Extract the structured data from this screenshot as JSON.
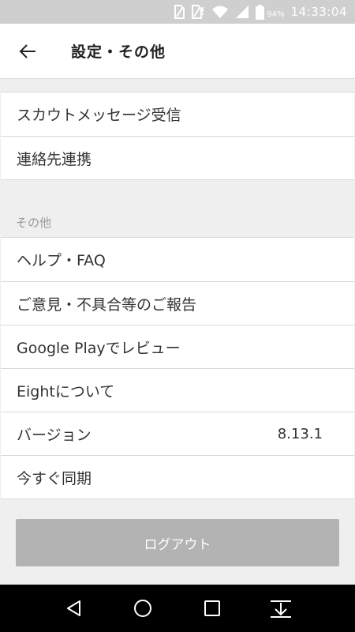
{
  "status_bar": {
    "battery_percent": "94%",
    "time": "14:33:04",
    "icons": [
      "no-sim-icon",
      "no-sim-icon",
      "wifi-icon",
      "signal-icon",
      "battery-icon"
    ]
  },
  "app_bar": {
    "title": "設定・その他",
    "back_icon": "arrow-left-icon"
  },
  "settings_group_1": {
    "items": [
      {
        "label": "スカウトメッセージ受信"
      },
      {
        "label": "連絡先連携"
      }
    ]
  },
  "other_section": {
    "header": "その他",
    "items": [
      {
        "label": "ヘルプ・FAQ"
      },
      {
        "label": "ご意見・不具合等のご報告"
      },
      {
        "label": "Google Playでレビュー"
      },
      {
        "label": "Eightについて"
      },
      {
        "label": "バージョン",
        "value": "8.13.1"
      },
      {
        "label": "今すぐ同期"
      }
    ]
  },
  "logout": {
    "label": "ログアウト",
    "color": "#b3b3b3"
  },
  "nav_bar": {
    "icons": [
      "back-triangle-icon",
      "home-circle-icon",
      "recents-square-icon",
      "notification-down-icon"
    ]
  }
}
